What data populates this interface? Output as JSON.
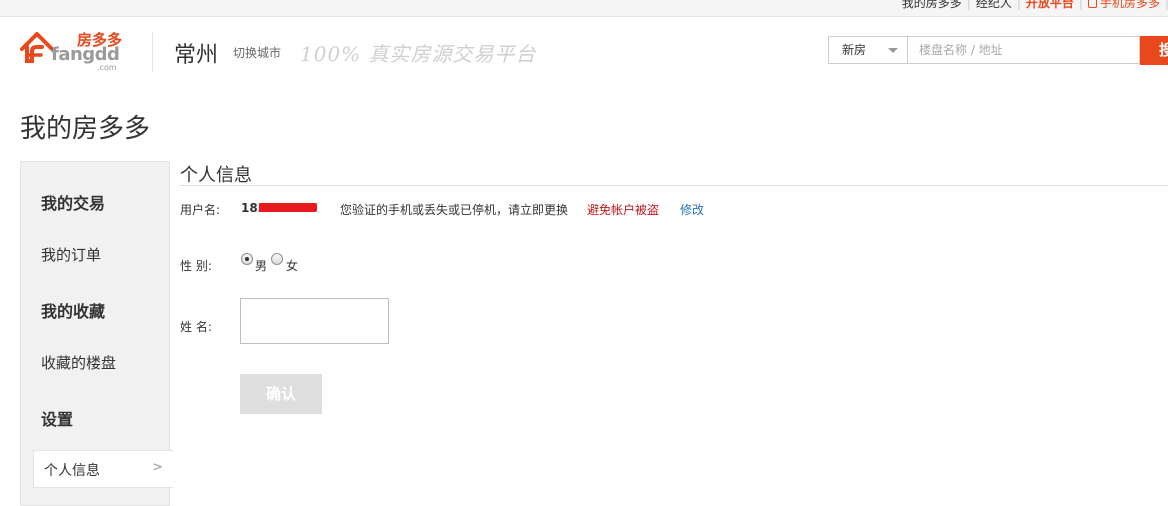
{
  "topbar": {
    "links": [
      "我的房多多",
      "经纪人",
      "开放平台",
      "手机房多多"
    ]
  },
  "header": {
    "logo_text": "房多多",
    "logo_domain": "fangdd",
    "logo_com": ".com",
    "city": "常州",
    "switch_city": "切换城市",
    "slogan": "100% 真实房源交易平台"
  },
  "search": {
    "type": "新房",
    "placeholder": "楼盘名称 / 地址",
    "button": "搜"
  },
  "page_title": "我的房多多",
  "sidebar": {
    "section_trade": "我的交易",
    "my_orders": "我的订单",
    "section_fav": "我的收藏",
    "fav_buildings": "收藏的楼盘",
    "section_settings": "设置",
    "personal_info": "个人信息",
    "arrow": ">"
  },
  "profile": {
    "title": "个人信息",
    "username_label": "用户名:",
    "username_prefix": "183",
    "phone_notice": "您验证的手机或丢失或已停机，请立即更换",
    "warning_link": "避免帐户被盗",
    "edit_link": "修改",
    "gender_label": "性 别:",
    "gender_male": "男",
    "gender_female": "女",
    "gender_selected": "男",
    "name_label": "姓 名:",
    "confirm_button": "确认"
  },
  "colors": {
    "brand": "#e8481b",
    "warning": "#c0181b",
    "link": "#2a73c0"
  }
}
